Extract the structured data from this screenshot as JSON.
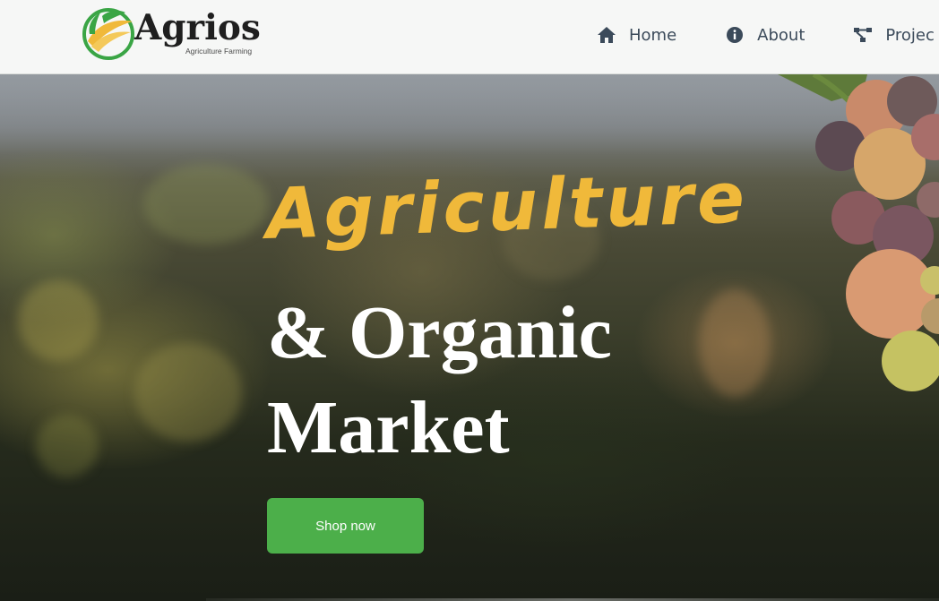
{
  "brand": {
    "name": "Agrios",
    "tagline": "Agriculture Farming"
  },
  "nav": {
    "items": [
      {
        "label": "Home",
        "icon": "home-icon"
      },
      {
        "label": "About",
        "icon": "info-icon"
      },
      {
        "label": "Projec",
        "icon": "projects-icon"
      }
    ]
  },
  "hero": {
    "script_heading": "Agriculture",
    "title_line1": "& Organic",
    "title_line2": "Market",
    "cta_label": "Shop now"
  },
  "colors": {
    "accent_green": "#4caf4a",
    "script_yellow": "#f0b93a",
    "nav_text": "#3b4a5a"
  }
}
